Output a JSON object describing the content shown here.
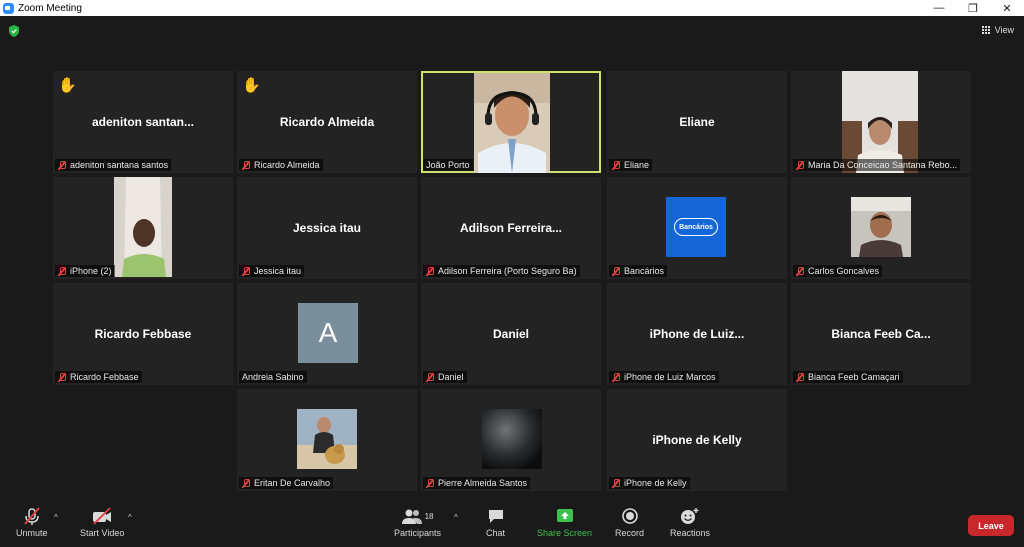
{
  "window": {
    "title": "Zoom Meeting",
    "minimize": "—",
    "restore": "❐",
    "close": "✕"
  },
  "header": {
    "view_label": "View"
  },
  "tiles": [
    {
      "display": "adeniton  santan...",
      "label": "adeniton santana santos",
      "hand": true
    },
    {
      "display": "Ricardo Almeida",
      "label": "Ricardo Almeida",
      "hand": true
    },
    {
      "display": "",
      "label": "João Porto",
      "active": true,
      "video": true
    },
    {
      "display": "Eliane",
      "label": "Eliane"
    },
    {
      "display": "",
      "label": "Maria Da Conceicao Santana Rebo...",
      "video": true
    },
    {
      "display": "",
      "label": "iPhone (2)",
      "video": true
    },
    {
      "display": "Jessica itau",
      "label": "Jessica itau"
    },
    {
      "display": "Adilson  Ferreira...",
      "label": "Adilson Ferreira (Porto Seguro Ba)"
    },
    {
      "display": "",
      "label": "Bancários",
      "logo_text": "Bancários"
    },
    {
      "display": "",
      "label": "Carlos Goncalves",
      "video": true
    },
    {
      "display": "Ricardo Febbase",
      "label": "Ricardo Febbase"
    },
    {
      "display": "",
      "label": "Andreia Sabino",
      "avatar_letter": "A"
    },
    {
      "display": "Daniel",
      "label": "Daniel"
    },
    {
      "display": "iPhone de Luiz...",
      "label": "iPhone de Luiz Marcos"
    },
    {
      "display": "Bianca Feeb Ca...",
      "label": "Bianca Feeb Camaçari"
    },
    {
      "display": "",
      "label": "Eritan De Carvalho",
      "video": true
    },
    {
      "display": "",
      "label": "Pierre Almeida Santos",
      "video": true
    },
    {
      "display": "iPhone de Kelly",
      "label": "iPhone de Kelly"
    }
  ],
  "toolbar": {
    "unmute": "Unmute",
    "start_video": "Start Video",
    "participants": "Participants",
    "participants_count": "18",
    "chat": "Chat",
    "share_screen": "Share Screen",
    "record": "Record",
    "reactions": "Reactions",
    "leave": "Leave"
  },
  "colors": {
    "background": "#1a1a1a",
    "tile": "#232323",
    "active_outline": "#cfe26b",
    "share_green": "#3fc04a",
    "leave_red": "#c6282b",
    "muted_red": "#e0403e"
  },
  "icons": {
    "raised_hand": "✋",
    "caret_up": "^"
  }
}
